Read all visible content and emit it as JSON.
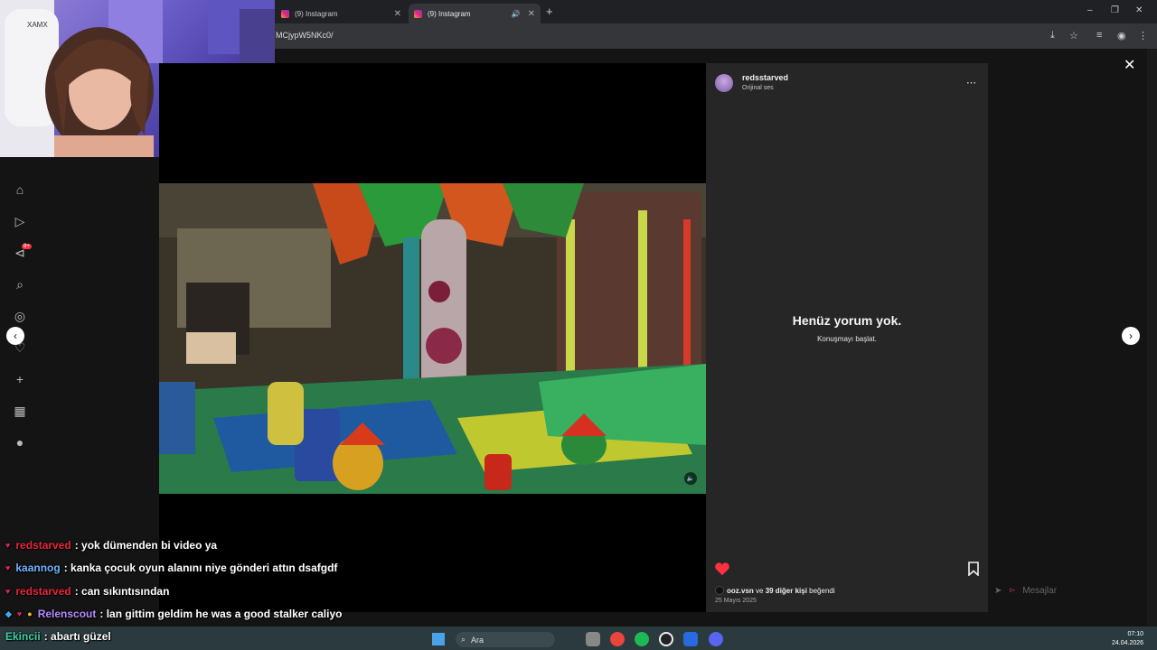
{
  "browser": {
    "tabs": [
      {
        "title": "(9) Instagram",
        "active": false
      },
      {
        "title": "(9) Instagram",
        "active": true
      }
    ],
    "url": "MCjypW5NKc0/",
    "window_controls": {
      "minimize": "–",
      "maximize": "❐",
      "close": "✕"
    }
  },
  "sidebar": {
    "notification_badge": "9+"
  },
  "post": {
    "author": "redsstarved",
    "audio": "Orijinal ses",
    "more_icon": "⋯",
    "empty_title": "Henüz yorum yok.",
    "empty_subtitle": "Konuşmayı başlat.",
    "liked_by_user": "ooz.vsn",
    "liked_by_mid": " ve ",
    "liked_by_others": "39 diğer kişi",
    "liked_by_suffix": " beğendi",
    "date": "25 Mayıs 2025",
    "like_color": "#ff3040"
  },
  "overlay_nav": {
    "close": "✕",
    "prev": "‹",
    "next": "›"
  },
  "messages": {
    "label": "Mesajlar",
    "badge": "9+"
  },
  "chat": [
    {
      "user": "redstarved",
      "color": "#e8263d",
      "text": ": yok dümenden bi video ya"
    },
    {
      "user": "kaannog",
      "color": "#6fb4ff",
      "text": ": kanka çocuk oyun alanını niye gönderi attın dsafgdf"
    },
    {
      "user": "redstarved",
      "color": "#e8263d",
      "text": ": can sıkıntısından"
    },
    {
      "user": "Relenscout",
      "color": "#b48cff",
      "text": ": lan gittim geldim he was a good stalker caliyo"
    },
    {
      "user": "Ekincii",
      "color": "#3fd1a0",
      "text": ": abartı güzel"
    }
  ],
  "taskbar": {
    "search": "Ara",
    "time": "07:10",
    "date": "24.04.2026"
  }
}
